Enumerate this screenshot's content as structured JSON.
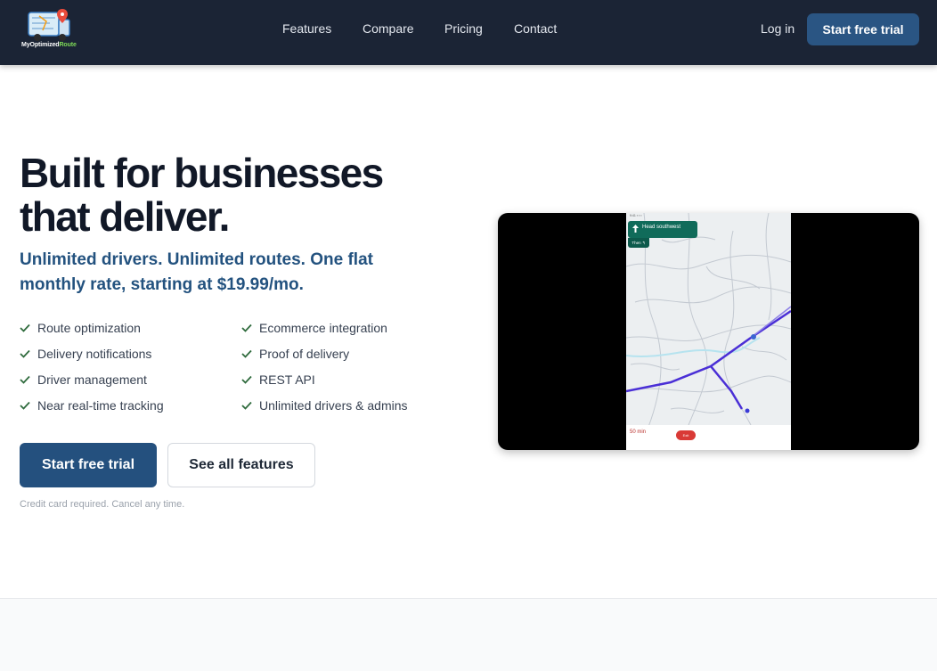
{
  "header": {
    "brand_name_part1": "MyOptimized",
    "brand_name_part2": "Route",
    "nav": [
      "Features",
      "Compare",
      "Pricing",
      "Contact"
    ],
    "login_label": "Log in",
    "cta_label": "Start free trial"
  },
  "hero": {
    "title": "Built for businesses that deliver.",
    "subtitle": "Unlimited drivers. Unlimited routes. One flat monthly rate, starting at $19.99/mo.",
    "features_left": [
      "Route optimization",
      "Delivery notifications",
      "Driver management",
      "Near real-time tracking"
    ],
    "features_right": [
      "Ecommerce integration",
      "Proof of delivery",
      "REST API",
      "Unlimited drivers & admins"
    ],
    "primary_cta": "Start free trial",
    "secondary_cta": "See all features",
    "fine_print": "Credit card required. Cancel any time."
  },
  "video": {
    "direction": "Head southwest",
    "then_label": "Then ↰",
    "eta": "50 min",
    "exit_label": "Exit"
  },
  "colors": {
    "header_bg": "#1b2435",
    "accent": "#24507e",
    "subtitle": "#23527f",
    "check": "#2f6b3d",
    "route": "#4a2fd6"
  }
}
